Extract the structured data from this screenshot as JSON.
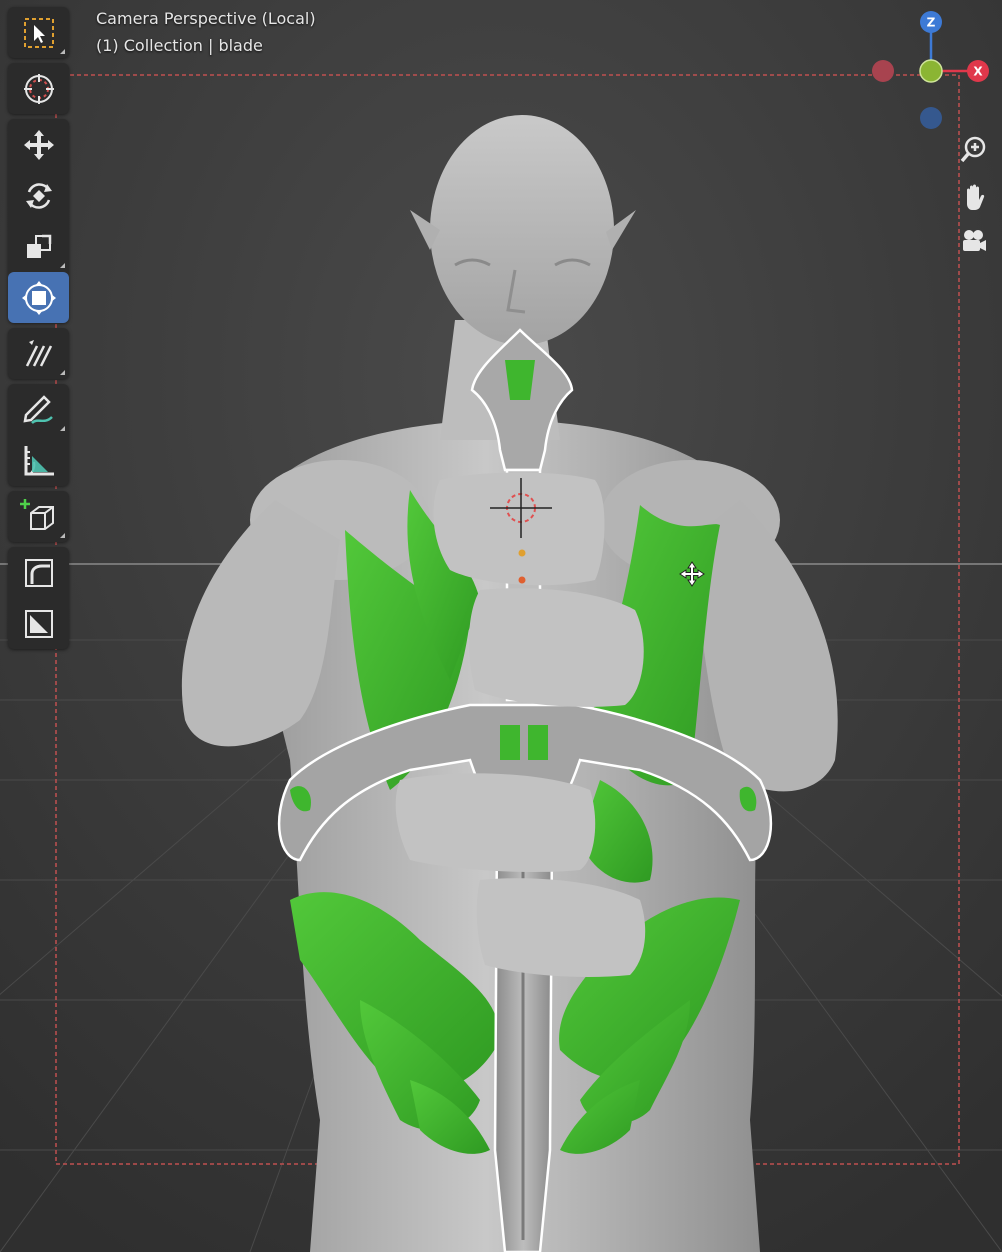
{
  "viewport": {
    "title": "Camera Perspective (Local)",
    "subtitle": "(1) Collection | blade"
  },
  "toolbar": {
    "tools": [
      {
        "name": "select-box",
        "icon": "select-cursor-icon",
        "active": false
      },
      {
        "name": "cursor",
        "icon": "3d-cursor-icon",
        "active": false
      },
      {
        "name": "move",
        "icon": "move-icon",
        "active": false
      },
      {
        "name": "rotate",
        "icon": "rotate-icon",
        "active": false
      },
      {
        "name": "scale",
        "icon": "scale-icon",
        "active": false
      },
      {
        "name": "transform",
        "icon": "transform-icon",
        "active": true
      },
      {
        "name": "annotate",
        "icon": "annotate-lines-icon",
        "active": false
      },
      {
        "name": "draw",
        "icon": "pencil-curve-icon",
        "active": false
      },
      {
        "name": "measure",
        "icon": "ruler-icon",
        "active": false
      },
      {
        "name": "add-cube",
        "icon": "add-cube-icon",
        "active": false
      },
      {
        "name": "bevel",
        "icon": "bevel-icon",
        "active": false
      },
      {
        "name": "inset",
        "icon": "inset-icon",
        "active": false
      }
    ]
  },
  "gizmo": {
    "z_label": "Z",
    "x_label": "X",
    "colors": {
      "x": "#e0384b",
      "y": "#8bb533",
      "z": "#3d7ad6"
    }
  },
  "nav": {
    "zoom_icon": "zoom-icon",
    "pan_icon": "hand-icon",
    "camera_icon": "camera-icon"
  },
  "colors": {
    "accent": "#4772b3",
    "selection_green": "#3fb62e",
    "model_gray": "#b5b5b5"
  }
}
